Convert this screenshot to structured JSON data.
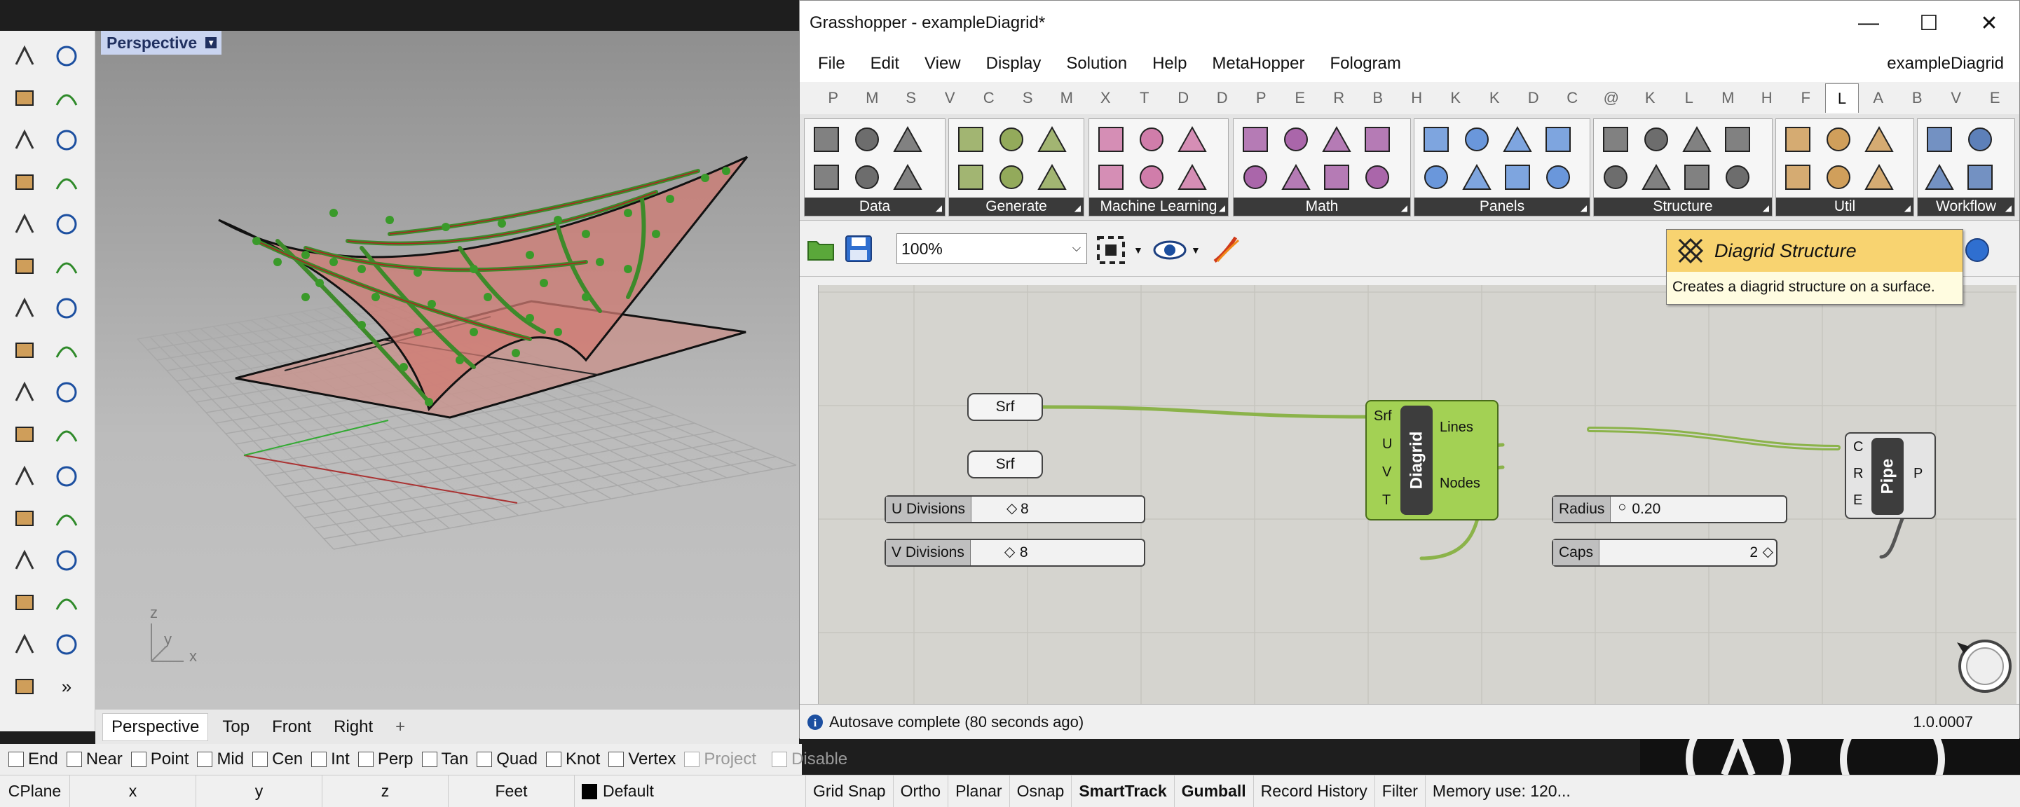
{
  "rhino": {
    "viewport_title": "Perspective",
    "viewport_tabs": [
      "Perspective",
      "Top",
      "Front",
      "Right"
    ],
    "add_tab_glyph": "+",
    "axis_labels": {
      "z": "z",
      "y": "y",
      "x": "x"
    },
    "toolbar_overflow": "»",
    "osnaps": [
      {
        "label": "End",
        "checked": false,
        "enabled": true
      },
      {
        "label": "Near",
        "checked": false,
        "enabled": true
      },
      {
        "label": "Point",
        "checked": false,
        "enabled": true
      },
      {
        "label": "Mid",
        "checked": false,
        "enabled": true
      },
      {
        "label": "Cen",
        "checked": false,
        "enabled": true
      },
      {
        "label": "Int",
        "checked": false,
        "enabled": true
      },
      {
        "label": "Perp",
        "checked": false,
        "enabled": true
      },
      {
        "label": "Tan",
        "checked": false,
        "enabled": true
      },
      {
        "label": "Quad",
        "checked": false,
        "enabled": true
      },
      {
        "label": "Knot",
        "checked": false,
        "enabled": true
      },
      {
        "label": "Vertex",
        "checked": false,
        "enabled": true
      },
      {
        "label": "Project",
        "checked": false,
        "enabled": false
      },
      {
        "label": "Disable",
        "checked": false,
        "enabled": false
      }
    ],
    "status": {
      "cplane": "CPlane",
      "x": "x",
      "y": "y",
      "z": "z",
      "units": "Feet",
      "layer": "Default",
      "layer_color": "#000000",
      "grid_snap": "Grid Snap",
      "ortho": "Ortho",
      "planar": "Planar",
      "osnap": "Osnap",
      "smarttrack": "SmartTrack",
      "gumball": "Gumball",
      "record_history": "Record History",
      "filter": "Filter",
      "memory": "Memory use: 120..."
    }
  },
  "gh": {
    "title": "Grasshopper - exampleDiagrid*",
    "menu": [
      "File",
      "Edit",
      "View",
      "Display",
      "Solution",
      "Help",
      "MetaHopper",
      "Fologram"
    ],
    "doc_name": "exampleDiagrid",
    "category_tabs": [
      "P",
      "M",
      "S",
      "V",
      "C",
      "S",
      "M",
      "X",
      "T",
      "D",
      "D",
      "P",
      "E",
      "R",
      "B",
      "H",
      "K",
      "K",
      "D",
      "C",
      "@",
      "K",
      "L",
      "M",
      "H",
      "F",
      "L",
      "A",
      "B",
      "V",
      "E"
    ],
    "active_tab_index": 26,
    "panels": [
      "Data",
      "Generate",
      "Machine Learning",
      "Math",
      "Panels",
      "Structure",
      "Util",
      "Workflow"
    ],
    "zoom": "100%",
    "tooltip": {
      "title": "Diagrid Structure",
      "description": "Creates a diagrid structure on a surface."
    },
    "canvas": {
      "srf1": "Srf",
      "srf2": "Srf",
      "u_slider": {
        "name": "U Divisions",
        "value": "8"
      },
      "v_slider": {
        "name": "V Divisions",
        "value": "8"
      },
      "diagrid": {
        "nickname": "Diagrid",
        "inputs": [
          "Srf",
          "U",
          "V",
          "T"
        ],
        "outputs": [
          "Lines",
          "Nodes"
        ]
      },
      "radius_slider": {
        "name": "Radius",
        "value": "0.20"
      },
      "caps_slider": {
        "name": "Caps",
        "value": "2"
      },
      "pipe": {
        "nickname": "Pipe",
        "inputs": [
          "C",
          "R",
          "E"
        ],
        "outputs": [
          "P"
        ]
      }
    },
    "status_text": "Autosave complete (80 seconds ago)",
    "version": "1.0.0007",
    "wire_color": "#8bb34a",
    "component_color": "#a3d154"
  }
}
